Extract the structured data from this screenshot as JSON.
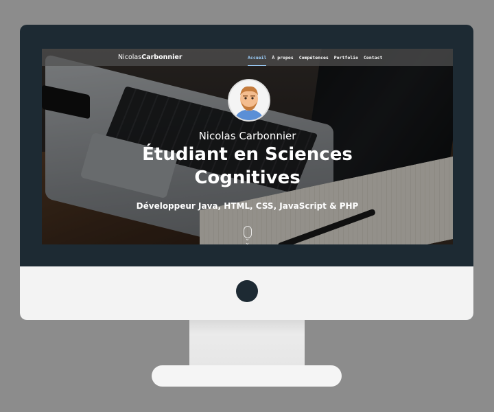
{
  "navbar": {
    "brand_first": "Nicolas",
    "brand_last": "Carbonnier",
    "links": [
      {
        "label": "Accueil",
        "active": true
      },
      {
        "label": "À propos",
        "active": false
      },
      {
        "label": "Compétences",
        "active": false
      },
      {
        "label": "Portfolio",
        "active": false
      },
      {
        "label": "Contact",
        "active": false
      }
    ]
  },
  "hero": {
    "name": "Nicolas Carbonnier",
    "title_line1": "Étudiant en Sciences",
    "title_line2": "Cognitives",
    "subtitle": "Développeur Java, HTML, CSS, JavaScript & PHP"
  },
  "colors": {
    "monitor_bezel": "#1d2a33",
    "nav_active": "#9fd2ff",
    "background": "#8c8c8c"
  },
  "icons": {
    "scroll": "mouse-scroll-icon",
    "chevron": "chevron-down-icon",
    "avatar": "avatar-illustration"
  }
}
